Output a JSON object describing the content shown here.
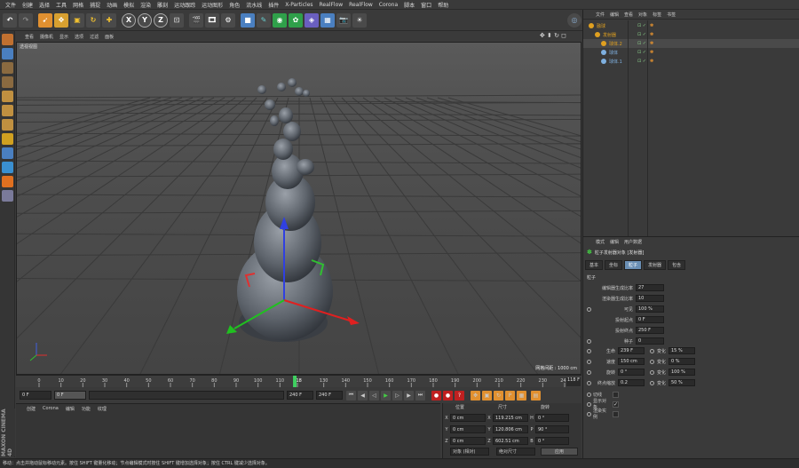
{
  "menubar": [
    "文件",
    "创建",
    "选择",
    "工具",
    "网格",
    "捕捉",
    "动画",
    "模拟",
    "渲染",
    "雕刻",
    "运动跟踪",
    "运动图形",
    "角色",
    "流水线",
    "插件",
    "X-Particles",
    "RealFlow",
    "RealFlow",
    "Corona",
    "脚本",
    "窗口",
    "帮助"
  ],
  "viewport": {
    "menu": [
      "查看",
      "摄像机",
      "显示",
      "选项",
      "过滤",
      "面板"
    ],
    "label": "透视视图",
    "grid_label": "网格间距 : 1000 cm"
  },
  "timeline": {
    "ticks": [
      "0",
      "10",
      "20",
      "30",
      "40",
      "50",
      "60",
      "70",
      "80",
      "90",
      "100",
      "110",
      "118",
      "130",
      "140",
      "150",
      "160",
      "170",
      "180",
      "190",
      "200",
      "210",
      "220",
      "230",
      "240"
    ],
    "current_frame": "118",
    "current_frame_field": "118 F"
  },
  "transport": {
    "start": "0 F",
    "range_start": "0 F",
    "range_end": "240 F",
    "end": "240 F"
  },
  "material": {
    "menu": [
      "创建",
      "Corona",
      "编辑",
      "功能",
      "纹理"
    ]
  },
  "coordinates": {
    "headers": [
      "位置",
      "尺寸",
      "旋转"
    ],
    "rows": [
      {
        "axis": "X",
        "pos": "0 cm",
        "size_axis": "X",
        "size": "119.215 cm",
        "rot_axis": "H",
        "rot": "0 °"
      },
      {
        "axis": "Y",
        "pos": "0 cm",
        "size_axis": "Y",
        "size": "120.806 cm",
        "rot_axis": "P",
        "rot": "90 °"
      },
      {
        "axis": "Z",
        "pos": "0 cm",
        "size_axis": "Z",
        "size": "602.51 cm",
        "rot_axis": "B",
        "rot": "0 °"
      }
    ],
    "mode_select": "对象 (相对)",
    "size_select": "绝对尺寸",
    "apply": "应用"
  },
  "objects": {
    "tabs": [
      "文件",
      "编辑",
      "查看",
      "对象",
      "标签",
      "书签"
    ],
    "items": [
      {
        "name": "融球",
        "indent": 0,
        "color": "#e0a020"
      },
      {
        "name": "发射器",
        "indent": 1,
        "color": "#e0a020"
      },
      {
        "name": "球体.2",
        "indent": 2,
        "color": "#e0a020"
      },
      {
        "name": "球体",
        "indent": 2,
        "color": "#7fb0e0"
      },
      {
        "name": "球体.1",
        "indent": 2,
        "color": "#7fb0e0"
      }
    ]
  },
  "attributes": {
    "menu": [
      "模式",
      "编辑",
      "用户数据"
    ],
    "title": "粒子发射器对象 [发射器]",
    "tabs": [
      "基本",
      "坐标",
      "粒子",
      "发射器",
      "包含"
    ],
    "active_tab": "粒子",
    "section": "粒子",
    "fields": [
      {
        "label": "编辑器生成比率",
        "value": "27"
      },
      {
        "label": "渲染器生成比率",
        "value": "10"
      },
      {
        "label": "可见",
        "value": "100 %"
      },
      {
        "label": "投射起点",
        "value": "0 F"
      },
      {
        "label": "投射终点",
        "value": "250 F"
      },
      {
        "label": "种子",
        "value": "0"
      }
    ],
    "pairs": [
      {
        "label": "生命",
        "value": "239 F",
        "label2": "变化",
        "value2": "15 %"
      },
      {
        "label": "速度",
        "value": "150 cm",
        "label2": "变化",
        "value2": "0 %"
      },
      {
        "label": "旋转",
        "value": "0 °",
        "label2": "变化",
        "value2": "100 %"
      },
      {
        "label": "终点缩放",
        "value": "0.2",
        "label2": "变化",
        "value2": "50 %"
      }
    ],
    "checks": [
      {
        "label": "切线",
        "value": ""
      },
      {
        "label": "显示对象",
        "value": "✓"
      },
      {
        "label": "渲染实例",
        "value": ""
      }
    ]
  },
  "status": "移动：点击并拖动鼠标移动元素。按住 SHIFT 键量化移动；节点编辑模式时按住 SHIFT 键增加选择对象；按住 CTRL 键减少选择对象。",
  "brand": "MAXON CINEMA 4D"
}
